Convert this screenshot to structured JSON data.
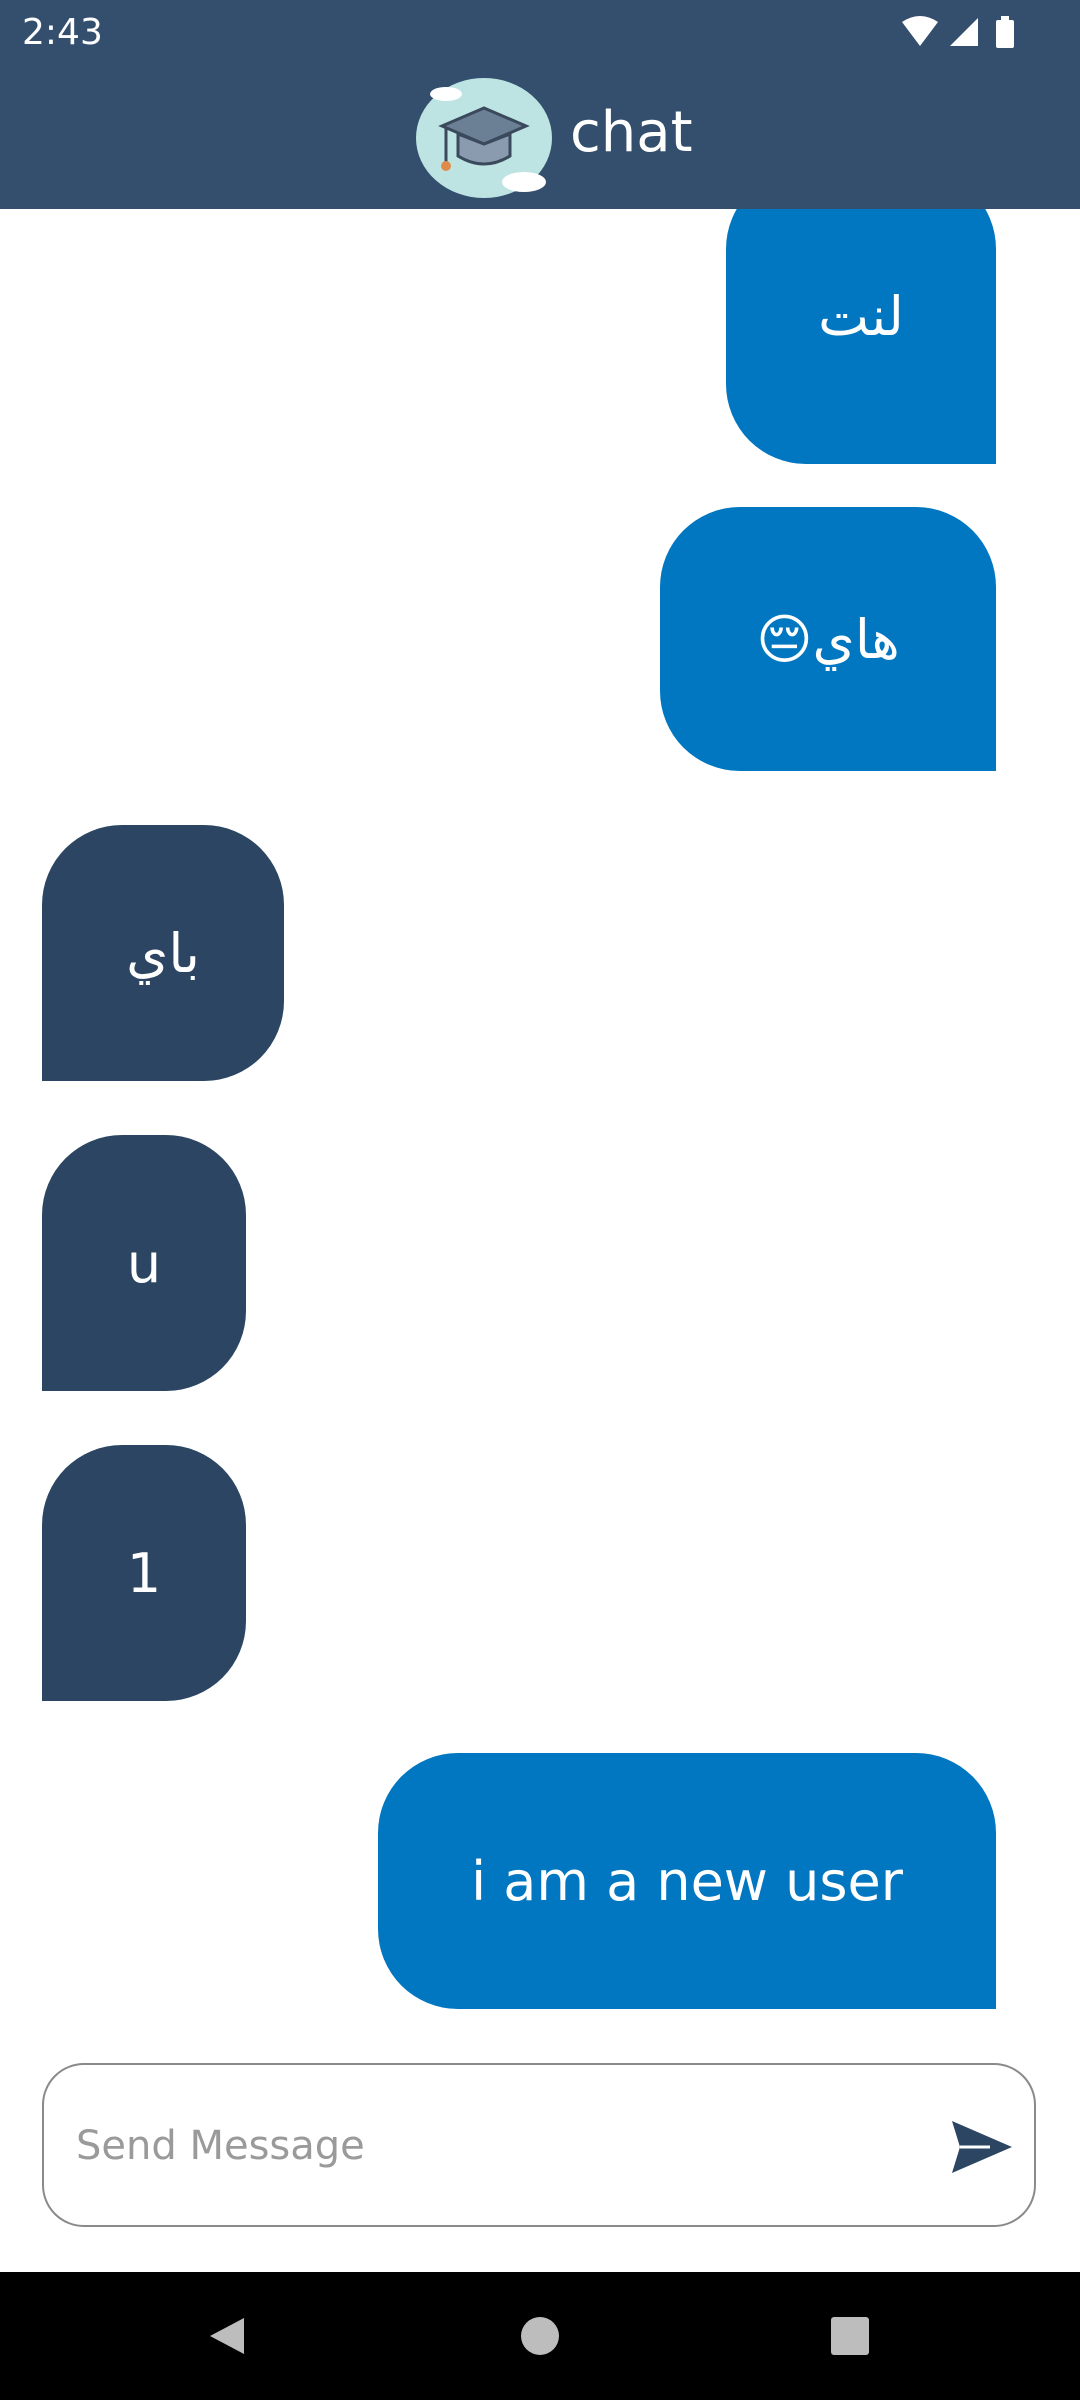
{
  "status_bar": {
    "time": "2:43",
    "icons": [
      "wifi-icon",
      "signal-icon",
      "battery-icon"
    ]
  },
  "app_bar": {
    "title": "chat",
    "logo_icon": "graduation-cap-cloud-logo"
  },
  "messages": [
    {
      "text": "لنت",
      "sender": "me"
    },
    {
      "text": "😔هاي",
      "sender": "me"
    },
    {
      "text": "باي",
      "sender": "other"
    },
    {
      "text": "u",
      "sender": "other"
    },
    {
      "text": "1",
      "sender": "other"
    },
    {
      "text": "i am a new user",
      "sender": "me"
    }
  ],
  "composer": {
    "placeholder": "Send Message",
    "value": "",
    "send_icon": "send-icon"
  },
  "nav_bar": {
    "icons": [
      "back-icon",
      "home-icon",
      "recents-icon"
    ]
  },
  "colors": {
    "app_bar": "#344f6e",
    "my_bubble": "#0277c1",
    "their_bubble": "#2b4562",
    "nav_bar": "#000000"
  }
}
